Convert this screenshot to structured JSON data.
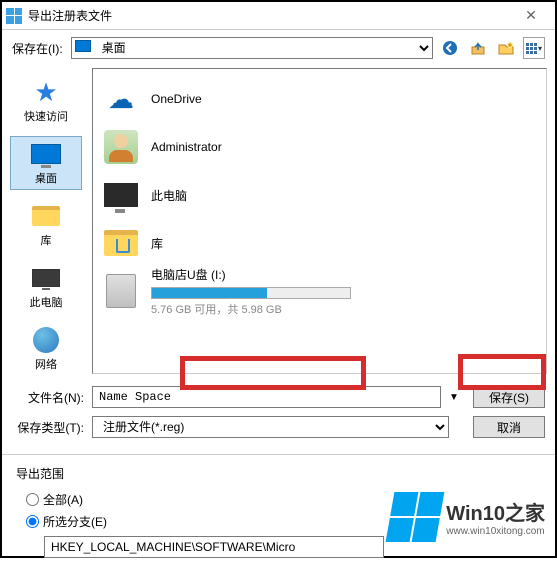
{
  "titlebar": {
    "title": "导出注册表文件"
  },
  "toprow": {
    "savein_label": "保存在(I):",
    "location": "桌面"
  },
  "sidebar": {
    "items": [
      {
        "label": "快速访问"
      },
      {
        "label": "桌面"
      },
      {
        "label": "库"
      },
      {
        "label": "此电脑"
      },
      {
        "label": "网络"
      }
    ]
  },
  "filelist": {
    "items": [
      {
        "label": "OneDrive"
      },
      {
        "label": "Administrator"
      },
      {
        "label": "此电脑"
      },
      {
        "label": "库"
      },
      {
        "label": "电脑店U盘 (I:)",
        "sub": "5.76 GB 可用，共 5.98 GB"
      }
    ]
  },
  "bottom": {
    "filename_label": "文件名(N):",
    "filename_value": "Name Space",
    "filetype_label": "保存类型(T):",
    "filetype_value": "注册文件(*.reg)",
    "save_label": "保存(S)",
    "cancel_label": "取消"
  },
  "export": {
    "group_title": "导出范围",
    "all_label": "全部(A)",
    "branch_label": "所选分支(E)",
    "branch_value": "HKEY_LOCAL_MACHINE\\SOFTWARE\\Micro"
  },
  "watermark": {
    "brand": "Win10之家",
    "url": "www.win10xitong.com"
  }
}
